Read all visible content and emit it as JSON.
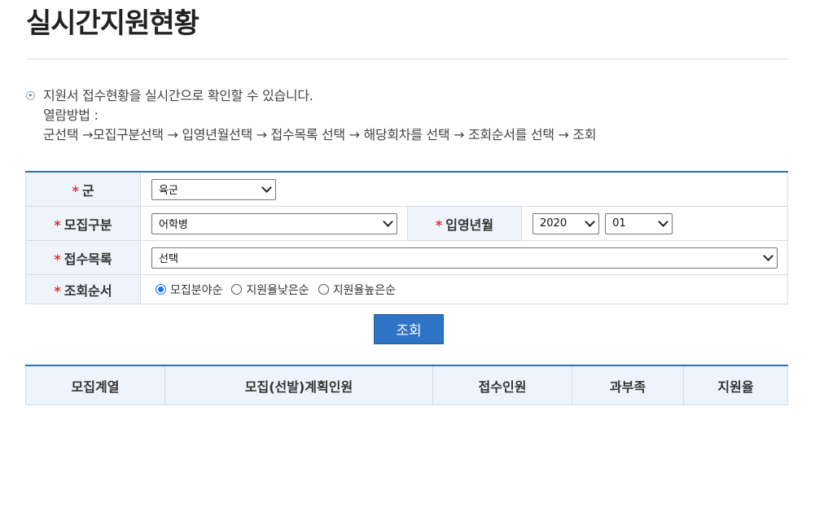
{
  "page": {
    "title": "실시간지원현황"
  },
  "info": {
    "lines": [
      "지원서 접수현황을 실시간으로 확인할 수 있습니다.",
      "열람방법 :",
      "군선택 →모집구분선택 → 입영년월선택 → 접수목록 선택 → 해당회차를 선택 → 조회순서를 선택 → 조회"
    ]
  },
  "form": {
    "required_mark": "*",
    "branch": {
      "label": "군",
      "value": "육군"
    },
    "recruit_type": {
      "label": "모집구분",
      "value": "어학병"
    },
    "enlist_month": {
      "label": "입영년월",
      "year": "2020",
      "month": "01"
    },
    "receipt_list": {
      "label": "접수목록",
      "value": "선택"
    },
    "sort_order": {
      "label": "조회순서",
      "options": [
        "모집분야순",
        "지원율낮은순",
        "지원율높은순"
      ],
      "selected_index": 0
    }
  },
  "search_button": {
    "label": "조회"
  },
  "results": {
    "columns": [
      "모집계열",
      "모집(선발)계획인원",
      "접수인원",
      "과부족",
      "지원율"
    ]
  }
}
